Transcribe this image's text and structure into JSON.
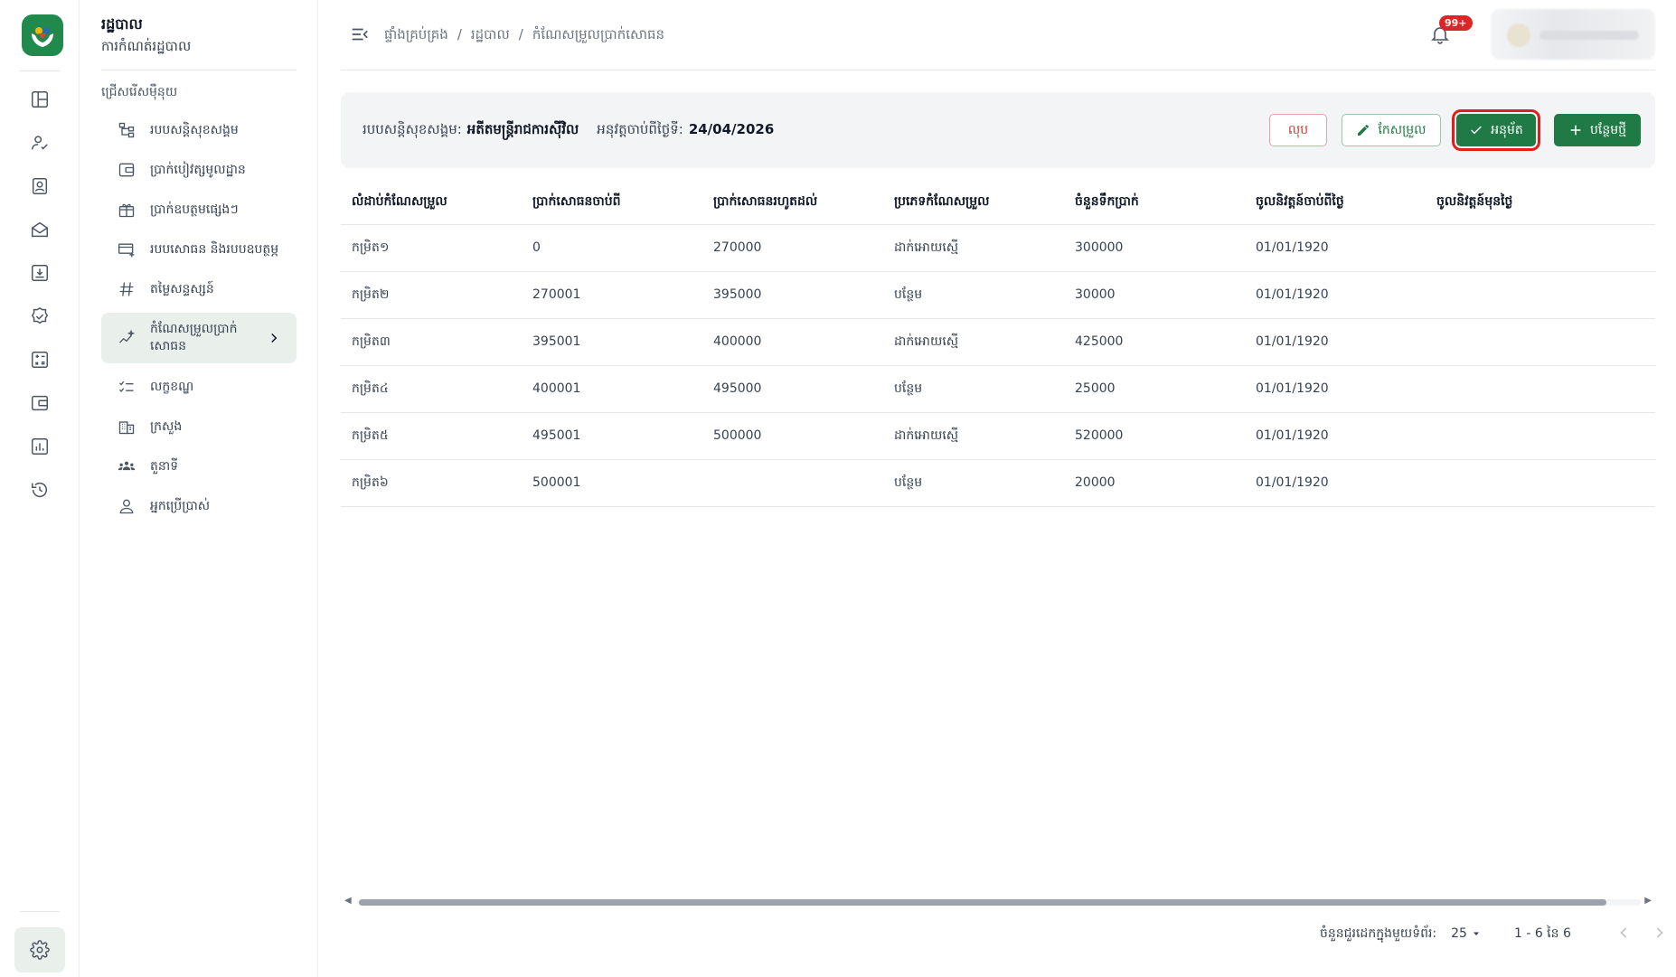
{
  "app": {
    "title": "រដ្ឋបាល",
    "subtitle": "ការកំណត់រដ្ឋបាល",
    "brand_color": "#1f8a4c",
    "accent_color": "#1f7a45"
  },
  "rail": {
    "icons": [
      "dashboard-icon",
      "user-check-icon",
      "id-card-icon",
      "envelope-icon",
      "download-box-icon",
      "badge-check-icon",
      "calculator-icon",
      "wallet-icon",
      "bar-chart-icon",
      "history-icon"
    ],
    "settings_icon": "gear-icon"
  },
  "sidebar": {
    "section_label": "ជ្រើសរើសម៉ឺនុយ",
    "items": [
      {
        "label": "របបសន្តិសុខសង្គម",
        "icon": "hierarchy-icon"
      },
      {
        "label": "ប្រាក់បៀវត្សមូលដ្ឋាន",
        "icon": "wallet-icon"
      },
      {
        "label": "ប្រាក់ឧបត្ថមផ្សេងៗ",
        "icon": "gift-icon"
      },
      {
        "label": "របបសោធន និងរបបឧបត្ថម្ភ",
        "icon": "card-add-icon"
      },
      {
        "label": "តម្លៃសន្ទស្សន៍",
        "icon": "hash-icon"
      },
      {
        "label": "កំណែសម្រួលប្រាក់សោធន",
        "icon": "sparkle-chart-icon",
        "active": true
      },
      {
        "label": "លក្ខខណ្ឌ",
        "icon": "checklist-icon"
      },
      {
        "label": "ក្រសួង",
        "icon": "building-icon"
      },
      {
        "label": "តួនាទី",
        "icon": "group-icon"
      },
      {
        "label": "អ្នកប្រើប្រាស់",
        "icon": "person-icon"
      }
    ]
  },
  "header": {
    "breadcrumb": [
      "ផ្ទាំងគ្រប់គ្រង",
      "/",
      "រដ្ឋបាល",
      "/",
      "កំណែសម្រួលប្រាក់សោធន"
    ],
    "notification_badge": "99+"
  },
  "info": {
    "scheme_label": "របបសន្តិសុខសង្គម:",
    "scheme_value": "អតីតមន្ត្រីរាជការស៊ីវិល",
    "effective_label": "អនុវត្តចាប់ពីថ្ងៃទី:",
    "effective_value": "24/04/2026"
  },
  "actions": {
    "delete_label": "លុប",
    "edit_label": "កែសម្រួល",
    "approve_label": "អនុម័ត",
    "add_label": "បន្ថែមថ្មី"
  },
  "table": {
    "columns": [
      "លំដាប់កំណែសម្រួល",
      "ប្រាក់សោធនចាប់ពី",
      "ប្រាក់សោធនរហូតដល់",
      "ប្រភេទកំណែសម្រួល",
      "ចំនួនទឹកប្រាក់",
      "ចូលនិវត្តន៍ចាប់ពីថ្ងៃ",
      "ចូលនិវត្តន៍មុនថ្ងៃ"
    ],
    "rows": [
      [
        "កម្រិត១",
        "0",
        "270000",
        "ដាក់អោយស្មើ",
        "300000",
        "01/01/1920",
        ""
      ],
      [
        "កម្រិត២",
        "270001",
        "395000",
        "បន្ថែម",
        "30000",
        "01/01/1920",
        ""
      ],
      [
        "កម្រិត៣",
        "395001",
        "400000",
        "ដាក់អោយស្មើ",
        "425000",
        "01/01/1920",
        ""
      ],
      [
        "កម្រិត៤",
        "400001",
        "495000",
        "បន្ថែម",
        "25000",
        "01/01/1920",
        ""
      ],
      [
        "កម្រិត៥",
        "495001",
        "500000",
        "ដាក់អោយស្មើ",
        "520000",
        "01/01/1920",
        ""
      ],
      [
        "កម្រិត៦",
        "500001",
        "",
        "បន្ថែម",
        "20000",
        "01/01/1920",
        ""
      ]
    ]
  },
  "pagination": {
    "rows_per_page_label": "ចំនួនជួរដេកក្នុងមួយទំព័រ:",
    "rows_per_page": "25",
    "range": "1 - 6 នៃ 6"
  }
}
